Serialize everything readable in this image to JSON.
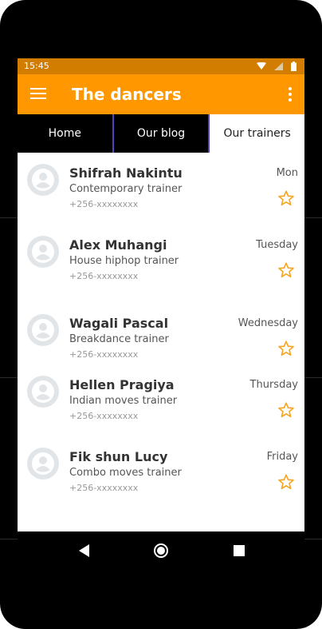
{
  "status_bar": {
    "time": "15:45"
  },
  "app_bar": {
    "title": "The dancers"
  },
  "tabs": [
    {
      "label": "Home",
      "active": false
    },
    {
      "label": "Our blog",
      "active": false
    },
    {
      "label": "Our trainers",
      "active": true
    }
  ],
  "trainers": [
    {
      "name": "Shifrah Nakintu",
      "role": "Contemporary trainer",
      "phone": "+256-xxxxxxxx",
      "day": "Mon"
    },
    {
      "name": "Alex Muhangi",
      "role": "House hiphop trainer",
      "phone": "+256-xxxxxxxx",
      "day": "Tuesday"
    },
    {
      "name": "Wagali Pascal",
      "role": "Breakdance trainer",
      "phone": "+256-xxxxxxxx",
      "day": "Wednesday"
    },
    {
      "name": "Hellen Pragiya",
      "role": "Indian moves trainer",
      "phone": "+256-xxxxxxxx",
      "day": "Thursday"
    },
    {
      "name": "Fik shun Lucy",
      "role": "Combo moves trainer",
      "phone": "+256-xxxxxxxx",
      "day": "Friday"
    }
  ],
  "icons": {
    "menu": "menu-icon",
    "overflow": "more-vert-icon",
    "avatar": "person-icon",
    "favorite": "star-outline-icon",
    "back": "back-icon",
    "home": "home-icon",
    "recents": "recents-icon"
  },
  "colors": {
    "primary": "#ff9800",
    "status_bar": "#d27d00",
    "star": "#f5a623",
    "tab_dark": "#000000"
  }
}
